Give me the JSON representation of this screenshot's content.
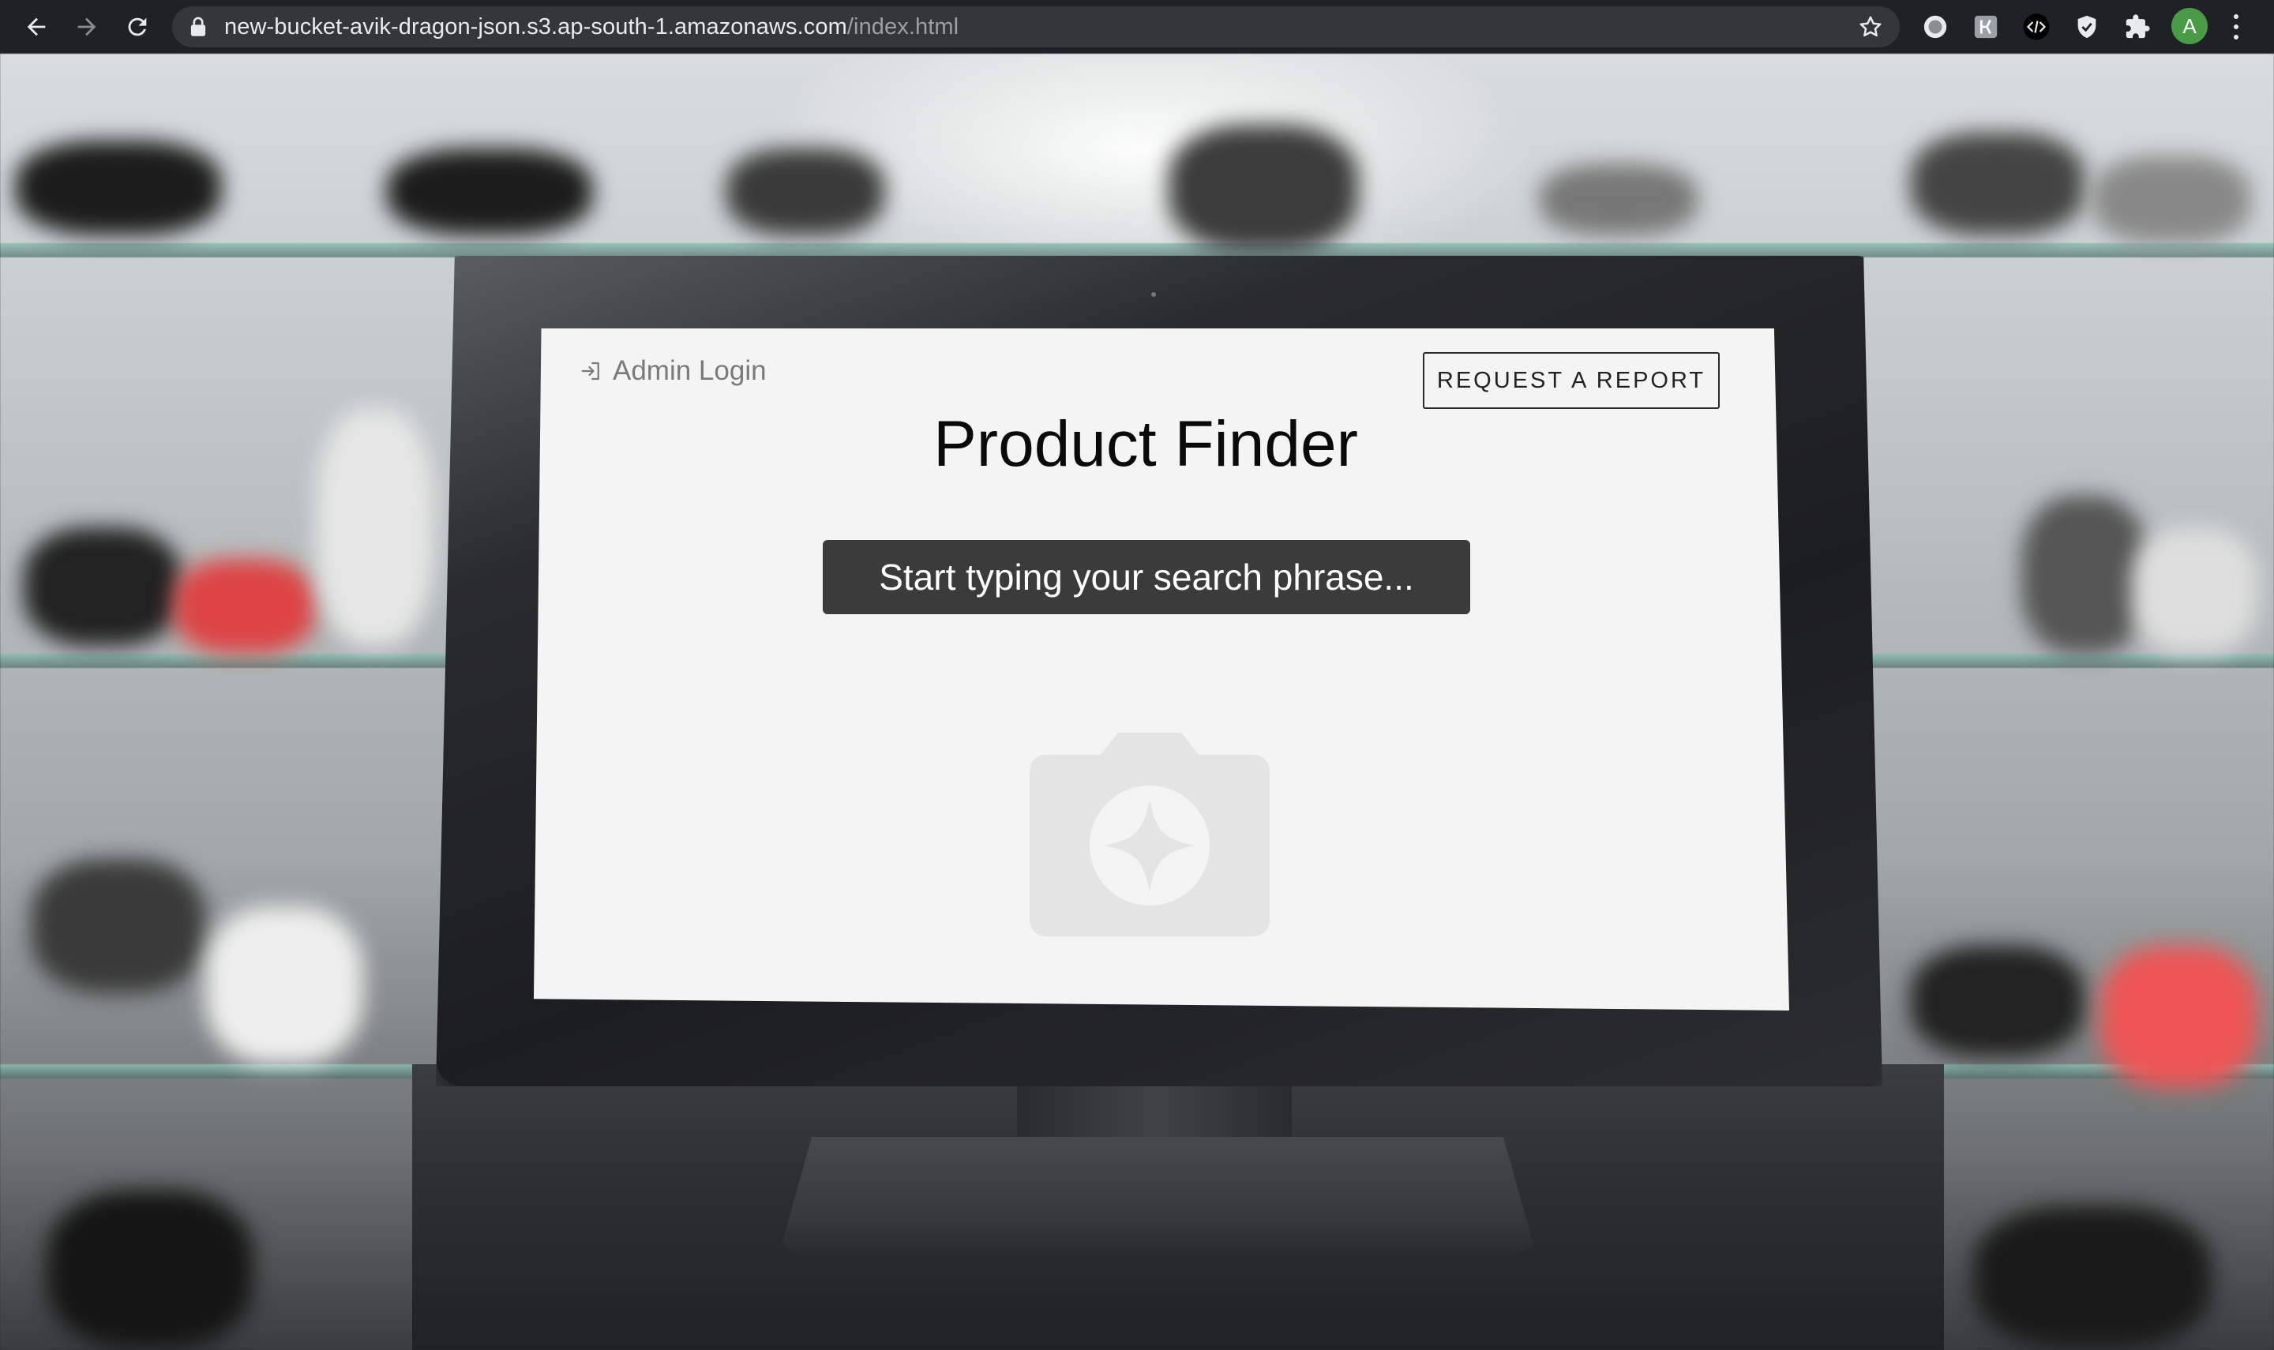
{
  "browser": {
    "url_host": "new-bucket-avik-dragon-json.s3.ap-south-1.amazonaws.com",
    "url_path": "/index.html",
    "profile_initial": "A",
    "icons": [
      "back-arrow-icon",
      "forward-arrow-icon",
      "reload-icon",
      "lock-icon",
      "bookmark-star-icon",
      "extension-icons",
      "puzzle-icon",
      "kebab-menu-icon"
    ]
  },
  "page": {
    "admin_login_label": "Admin Login",
    "request_report_label": "REQUEST A REPORT",
    "title": "Product Finder",
    "search_placeholder": "Start typing your search phrase...",
    "camera_icon": "camera-sparkle-icon"
  },
  "colors": {
    "chrome_bg": "#202124",
    "omnibox_bg": "#35363a",
    "screen_bg": "#f4f4f4",
    "search_bg": "#3b3b3b",
    "avatar_bg": "#4a9b46"
  }
}
